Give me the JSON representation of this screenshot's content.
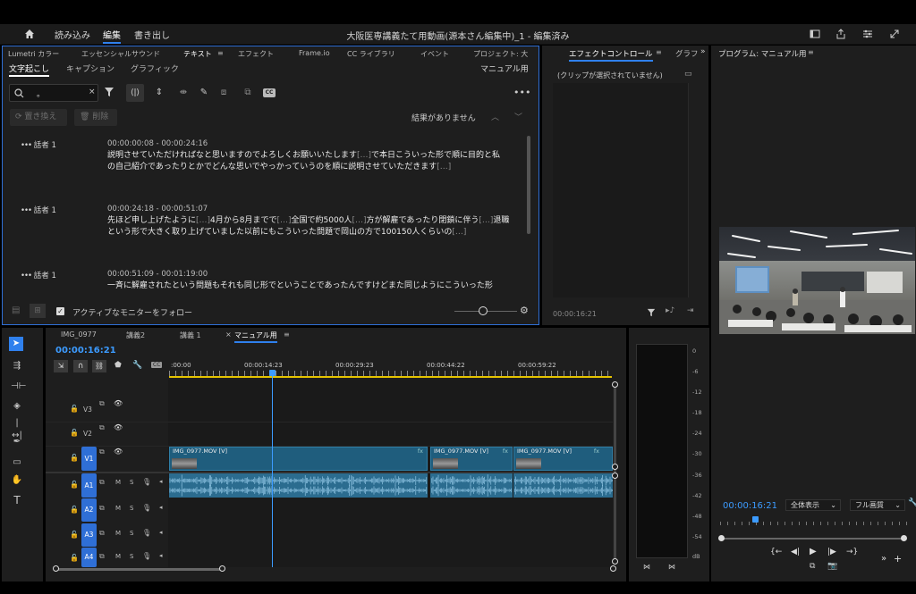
{
  "header": {
    "home_icon": "home-icon",
    "nav": [
      "読み込み",
      "編集",
      "書き出し"
    ],
    "active_nav": "編集",
    "title": "大阪医専講義たて用動画(源本さん編集中)_1 - 編集済み",
    "right_icons": [
      "panel-icon",
      "share-icon",
      "workspaces-icon",
      "fullscreen-icon"
    ]
  },
  "text_panel": {
    "tabs": [
      "Lumetri カラー",
      "エッセンシャルサウンド",
      "テキスト",
      "エフェクト",
      "Frame.io",
      "CC ライブラリ",
      "イベント",
      "プロジェクト: 大"
    ],
    "active_tab": "テキスト",
    "subtabs": [
      "文字起こし",
      "キャプション",
      "グラフィック"
    ],
    "active_subtab": "文字起こし",
    "sequence_name": "マニュアル用",
    "search_value": "。",
    "replace_label": "置き換え",
    "delete_label": "削除",
    "no_results": "結果がありません",
    "segments": [
      {
        "speaker": "話者 1",
        "time": "00:00:00:08 - 00:00:24:16",
        "line1": "説明させていただければなと思いますのでよろしくお願いいたします",
        "gap1": "[…]",
        "line1b": "で本日こういった形で順に目的と私",
        "line2": "の自己紹介であったりとかでどんな思いでやっかっていうのを順に説明させていただきます",
        "gap2": "[…]"
      },
      {
        "speaker": "話者 1",
        "time": "00:00:24:18 - 00:00:51:07",
        "line1a": "先ほど申し上げたように",
        "gap1": "[…]",
        "line1b": "4月から8月までで",
        "gap2": "[…]",
        "line1c": "全国で約5000人",
        "gap3": "[…]",
        "line1d": "方が解雇であったり閉鎖に伴う",
        "gap4": "[…]",
        "line1e": "退職",
        "line2": "という形で大きく取り上げていました以前にもこういった問題で岡山の方で100150人くらいの",
        "gap5": "[…]"
      },
      {
        "speaker": "話者 1",
        "time": "00:00:51:09 - 00:01:19:00",
        "line1": "一斉に解雇されたという問題もそれも同じ形でということであったんですけどまた同じようにこういった形"
      }
    ],
    "follow_label": "アクティブなモニターをフォロー"
  },
  "effects_panel": {
    "tabs": [
      "エフェクトコントロール",
      "グラフ"
    ],
    "no_clip": "(クリップが選択されていません)",
    "timecode": "00:00:16:21"
  },
  "program_monitor": {
    "title": "プログラム: マニュアル用",
    "timecode": "00:00:16:21",
    "zoom": "全体表示",
    "quality": "フル画質"
  },
  "timeline": {
    "tabs": [
      "IMG_0977",
      "講義2",
      "講義 1",
      "マニュアル用"
    ],
    "active_tab": "マニュアル用",
    "timecode": "00:00:16:21",
    "ruler": [
      ":00:00",
      "00:00:14:23",
      "00:00:29:23",
      "00:00:44:22",
      "00:00:59:22"
    ],
    "video_tracks": [
      "V3",
      "V2",
      "V1"
    ],
    "audio_tracks": [
      "A1",
      "A2",
      "A3",
      "A4"
    ],
    "track_letters": [
      "M",
      "S"
    ],
    "clips": [
      "IMG_0977.MOV [V]",
      "IMG_0977.MOV [V]",
      "IMG_0977.MOV [V]"
    ]
  },
  "meter": {
    "scale": [
      "0",
      "-6",
      "-12",
      "-18",
      "-24",
      "-30",
      "-36",
      "-42",
      "-48",
      "-54",
      "dB"
    ]
  },
  "colors": {
    "accent_blue": "#2f80ed",
    "clip_blue": "#1f5d7d",
    "audio_blue": "#2b6c8f",
    "timecode_blue": "#3c9bff",
    "yellow": "#e5c400"
  }
}
